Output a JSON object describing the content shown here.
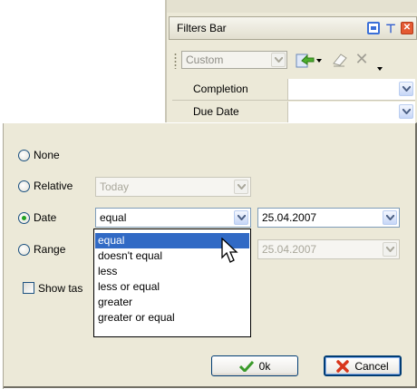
{
  "filters_panel": {
    "title": "Filters Bar",
    "view_select": {
      "value": "Custom"
    },
    "rows": [
      {
        "label": "Completion",
        "value": ""
      },
      {
        "label": "Due Date",
        "value": ""
      }
    ]
  },
  "dialog": {
    "options": {
      "none": "None",
      "relative": "Relative",
      "date": "Date",
      "range": "Range"
    },
    "selected_option": "Date",
    "relative_value": "Today",
    "date_condition": "equal",
    "date_value": "25.04.2007",
    "range_value": "25.04.2007",
    "dropdown_items": [
      "equal",
      "doesn't equal",
      "less",
      "less or equal",
      "greater",
      "greater or equal"
    ],
    "dropdown_selected_index": 0,
    "show_tasks_label": "Show tas",
    "ok_label": "0k",
    "cancel_label": "Cancel"
  },
  "colors": {
    "selection": "#316ac5",
    "panel_bg": "#ece9d8",
    "close_red": "#e45a33"
  }
}
